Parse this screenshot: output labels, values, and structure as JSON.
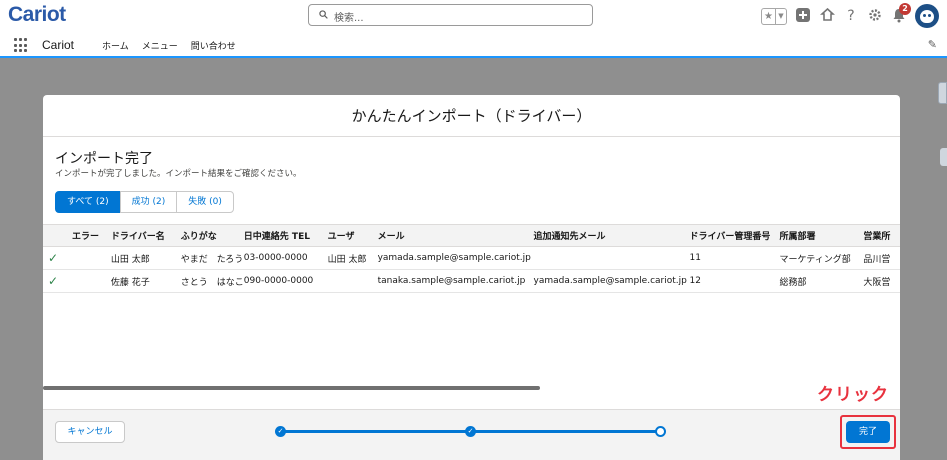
{
  "header": {
    "logo": "Cariot",
    "search_placeholder": "検索...",
    "notifications_count": "2",
    "favorites_icon": "star-icon",
    "icons": [
      "add-icon",
      "trailhead-icon",
      "help-icon",
      "gear-icon",
      "bell-icon"
    ]
  },
  "nav": {
    "app_name": "Cariot",
    "items": [
      "ホーム",
      "メニュー",
      "問い合わせ"
    ]
  },
  "modal": {
    "title": "かんたんインポート（ドライバー）",
    "section_title": "インポート完了",
    "message": "インポートが完了しました。インポート結果をご確認ください。",
    "filters": [
      {
        "label": "すべて (2)",
        "active": true
      },
      {
        "label": "成功 (2)",
        "active": false
      },
      {
        "label": "失敗 (0)",
        "active": false
      }
    ],
    "columns": [
      "エラー",
      "ドライバー名",
      "ふりがな",
      "日中連絡先 TEL",
      "ユーザ",
      "メール",
      "追加通知先メール",
      "ドライバー管理番号",
      "所属部署",
      "営業所"
    ],
    "rows": [
      {
        "status": "success",
        "name": "山田 太郎",
        "kana": "やまだ　たろう",
        "tel": "03-0000-0000",
        "user": "山田 太郎",
        "email": "yamada.sample@sample.cariot.jp",
        "notify": "",
        "number": "11",
        "dept": "マーケティング部",
        "office": "品川営"
      },
      {
        "status": "success",
        "name": "佐藤 花子",
        "kana": "さとう　はなこ",
        "tel": "090-0000-0000",
        "user": "",
        "email": "tanaka.sample@sample.cariot.jp",
        "notify": "yamada.sample@sample.cariot.jp",
        "number": "12",
        "dept": "総務部",
        "office": "大阪営"
      }
    ],
    "cancel_label": "キャンセル",
    "done_label": "完了",
    "steps": {
      "total": 3,
      "current": 3
    }
  },
  "annotation": {
    "click_label": "クリック",
    "color": "#e8323e"
  },
  "colors": {
    "brand": "#0176d3",
    "logo": "#2b5aa8",
    "success": "#2e844a"
  }
}
